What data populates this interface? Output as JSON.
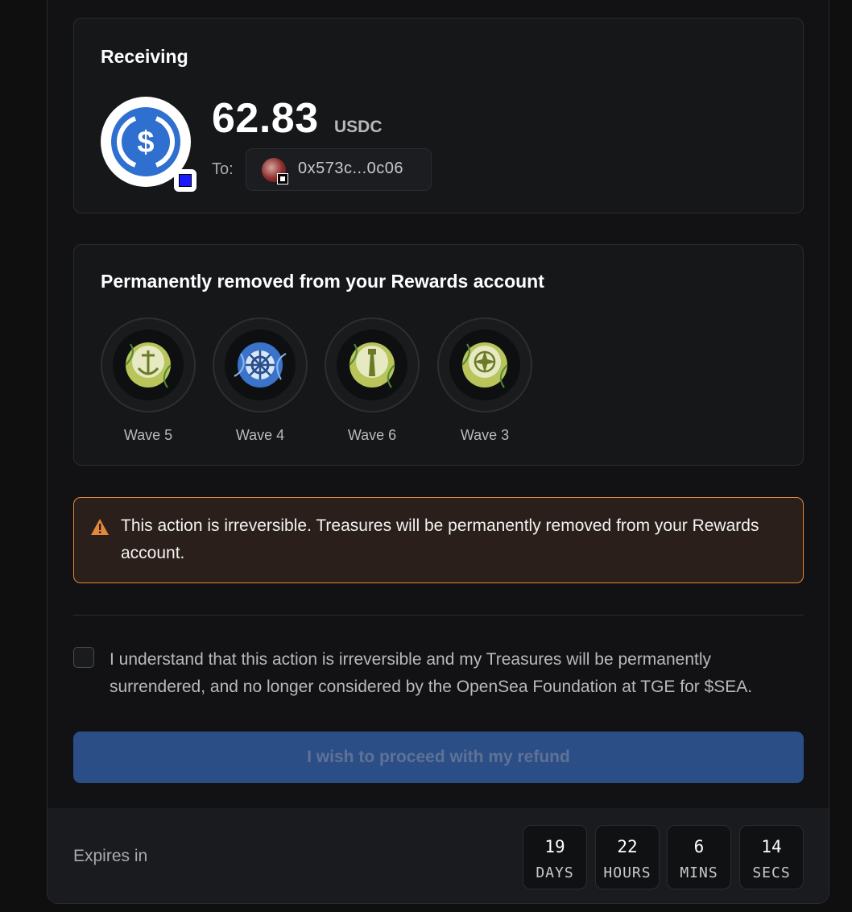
{
  "receiving": {
    "title": "Receiving",
    "amount": "62.83",
    "unit": "USDC",
    "to_label": "To:",
    "address": "0x573c...0c06",
    "token_icon": "usdc-icon",
    "chain_icon": "base-chain-icon"
  },
  "removed": {
    "title": "Permanently removed from your Rewards account",
    "treasures": [
      {
        "label": "Wave 5",
        "icon": "anchor-treasure-icon"
      },
      {
        "label": "Wave 4",
        "icon": "ship-wheel-treasure-icon"
      },
      {
        "label": "Wave 6",
        "icon": "lighthouse-treasure-icon"
      },
      {
        "label": "Wave 3",
        "icon": "compass-treasure-icon"
      }
    ]
  },
  "warning": {
    "text": "This action is irreversible. Treasures will be permanently removed from your Rewards account.",
    "icon": "warning-triangle-icon",
    "color": "#e2873b"
  },
  "consent": {
    "text": "I understand that this action is irreversible and my Treasures will be permanently surrendered, and no longer considered by the OpenSea Foundation at TGE for $SEA.",
    "checked": false
  },
  "proceed_button": {
    "label": "I wish to proceed with my refund",
    "color": "#2c4e86"
  },
  "expires": {
    "label": "Expires in",
    "countdown": [
      {
        "value": "19",
        "unit": "DAYS"
      },
      {
        "value": "22",
        "unit": "HOURS"
      },
      {
        "value": "6",
        "unit": "MINS"
      },
      {
        "value": "14",
        "unit": "SECS"
      }
    ]
  }
}
